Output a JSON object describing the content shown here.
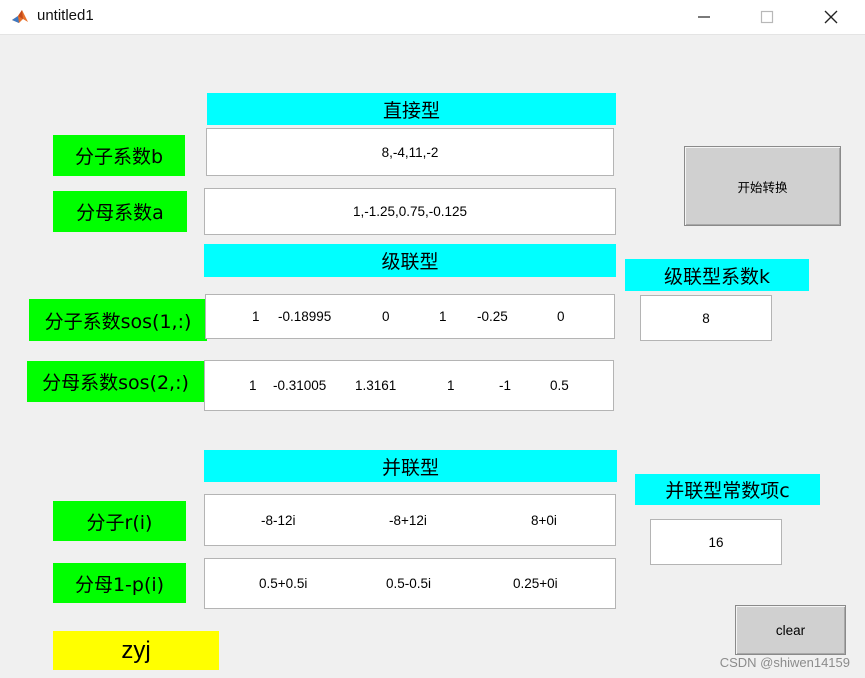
{
  "window": {
    "title": "untitled1",
    "icon": "matlab-icon",
    "controls": [
      "minimize-icon",
      "maximize-icon",
      "close-icon"
    ]
  },
  "direct": {
    "heading": "直接型",
    "num_label": "分子系数b",
    "num_value": "8,-4,11,-2",
    "den_label": "分母系数a",
    "den_value": "1,-1.25,0.75,-0.125"
  },
  "convert_button": "开始转换",
  "cascade": {
    "heading": "级联型",
    "num_label": "分子系数sos(1,:)",
    "num_values": [
      "1",
      "-0.18995",
      "0",
      "1",
      "-0.25",
      "0"
    ],
    "den_label": "分母系数sos(2,:)",
    "den_values": [
      "1",
      "-0.31005",
      "1.3161",
      "1",
      "-1",
      "0.5"
    ],
    "k_label": "级联型系数k",
    "k_value": "8"
  },
  "parallel": {
    "heading": "并联型",
    "num_label": "分子r(i)",
    "num_values": [
      "-8-12i",
      "-8+12i",
      "8+0i"
    ],
    "den_label": "分母1-p(i)",
    "den_values": [
      "0.5+0.5i",
      "0.5-0.5i",
      "0.25+0i"
    ],
    "c_label": "并联型常数项c",
    "c_value": "16"
  },
  "author_label": "zyj",
  "clear_button": "clear",
  "watermark": "CSDN @shiwen14159",
  "colors": {
    "heading_bg": "#00ffff",
    "label_bg": "#00ff00",
    "author_bg": "#ffff00",
    "window_bg": "#f0f0f0"
  }
}
